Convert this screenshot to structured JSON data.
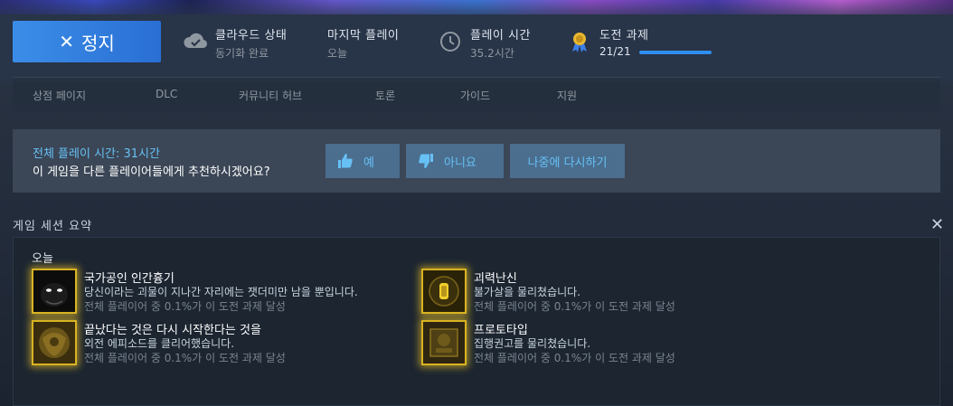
{
  "topbar": {
    "stop_label": "정지",
    "stop_icon": "close-icon",
    "cloud": {
      "label": "클라우드 상태",
      "value": "동기화 완료",
      "icon": "cloud-check-icon"
    },
    "last_played": {
      "label": "마지막 플레이",
      "value": "오늘"
    },
    "playtime": {
      "label": "플레이 시간",
      "value": "35.2시간",
      "icon": "clock-icon"
    },
    "achievements": {
      "label": "도전 과제",
      "value": "21/21",
      "progress": 1.0,
      "icon": "ribbon-medal-icon"
    }
  },
  "nav": {
    "items": [
      {
        "label": "상점 페이지"
      },
      {
        "label": "DLC"
      },
      {
        "label": "커뮤니티 허브"
      },
      {
        "label": "토론"
      },
      {
        "label": "가이드"
      },
      {
        "label": "지원"
      }
    ]
  },
  "recommend": {
    "total_playtime": "전체 플레이 시간: 31시간",
    "question": "이 게임을 다른 플레이어들에게 추천하시겠어요?",
    "yes_label": "예",
    "no_label": "아니요",
    "later_label": "나중에 다시하기",
    "accent_color": "#66c0f4"
  },
  "session": {
    "title": "게임 세션 요약",
    "day_label": "오늘",
    "achievements": [
      {
        "name": "국가공인 인간흉기",
        "desc": "당신이라는 괴물이 지나간 자리에는 잿더미만 남을 뿐입니다.",
        "pct": "전체 플레이어 중 0.1%가 이 도전 과제 달성"
      },
      {
        "name": "괴력난신",
        "desc": "불가살을 물리쳤습니다.",
        "pct": "전체 플레이어 중 0.1%가 이 도전 과제 달성"
      },
      {
        "name": "끝났다는 것은 다시 시작한다는 것을",
        "desc": "외전 에피소드를 클리어했습니다.",
        "pct": "전체 플레이어 중 0.1%가 이 도전 과제 달성"
      },
      {
        "name": "프로토타입",
        "desc": "집행권고를 물리쳤습니다.",
        "pct": "전체 플레이어 중 0.1%가 이 도전 과제 달성"
      }
    ]
  }
}
